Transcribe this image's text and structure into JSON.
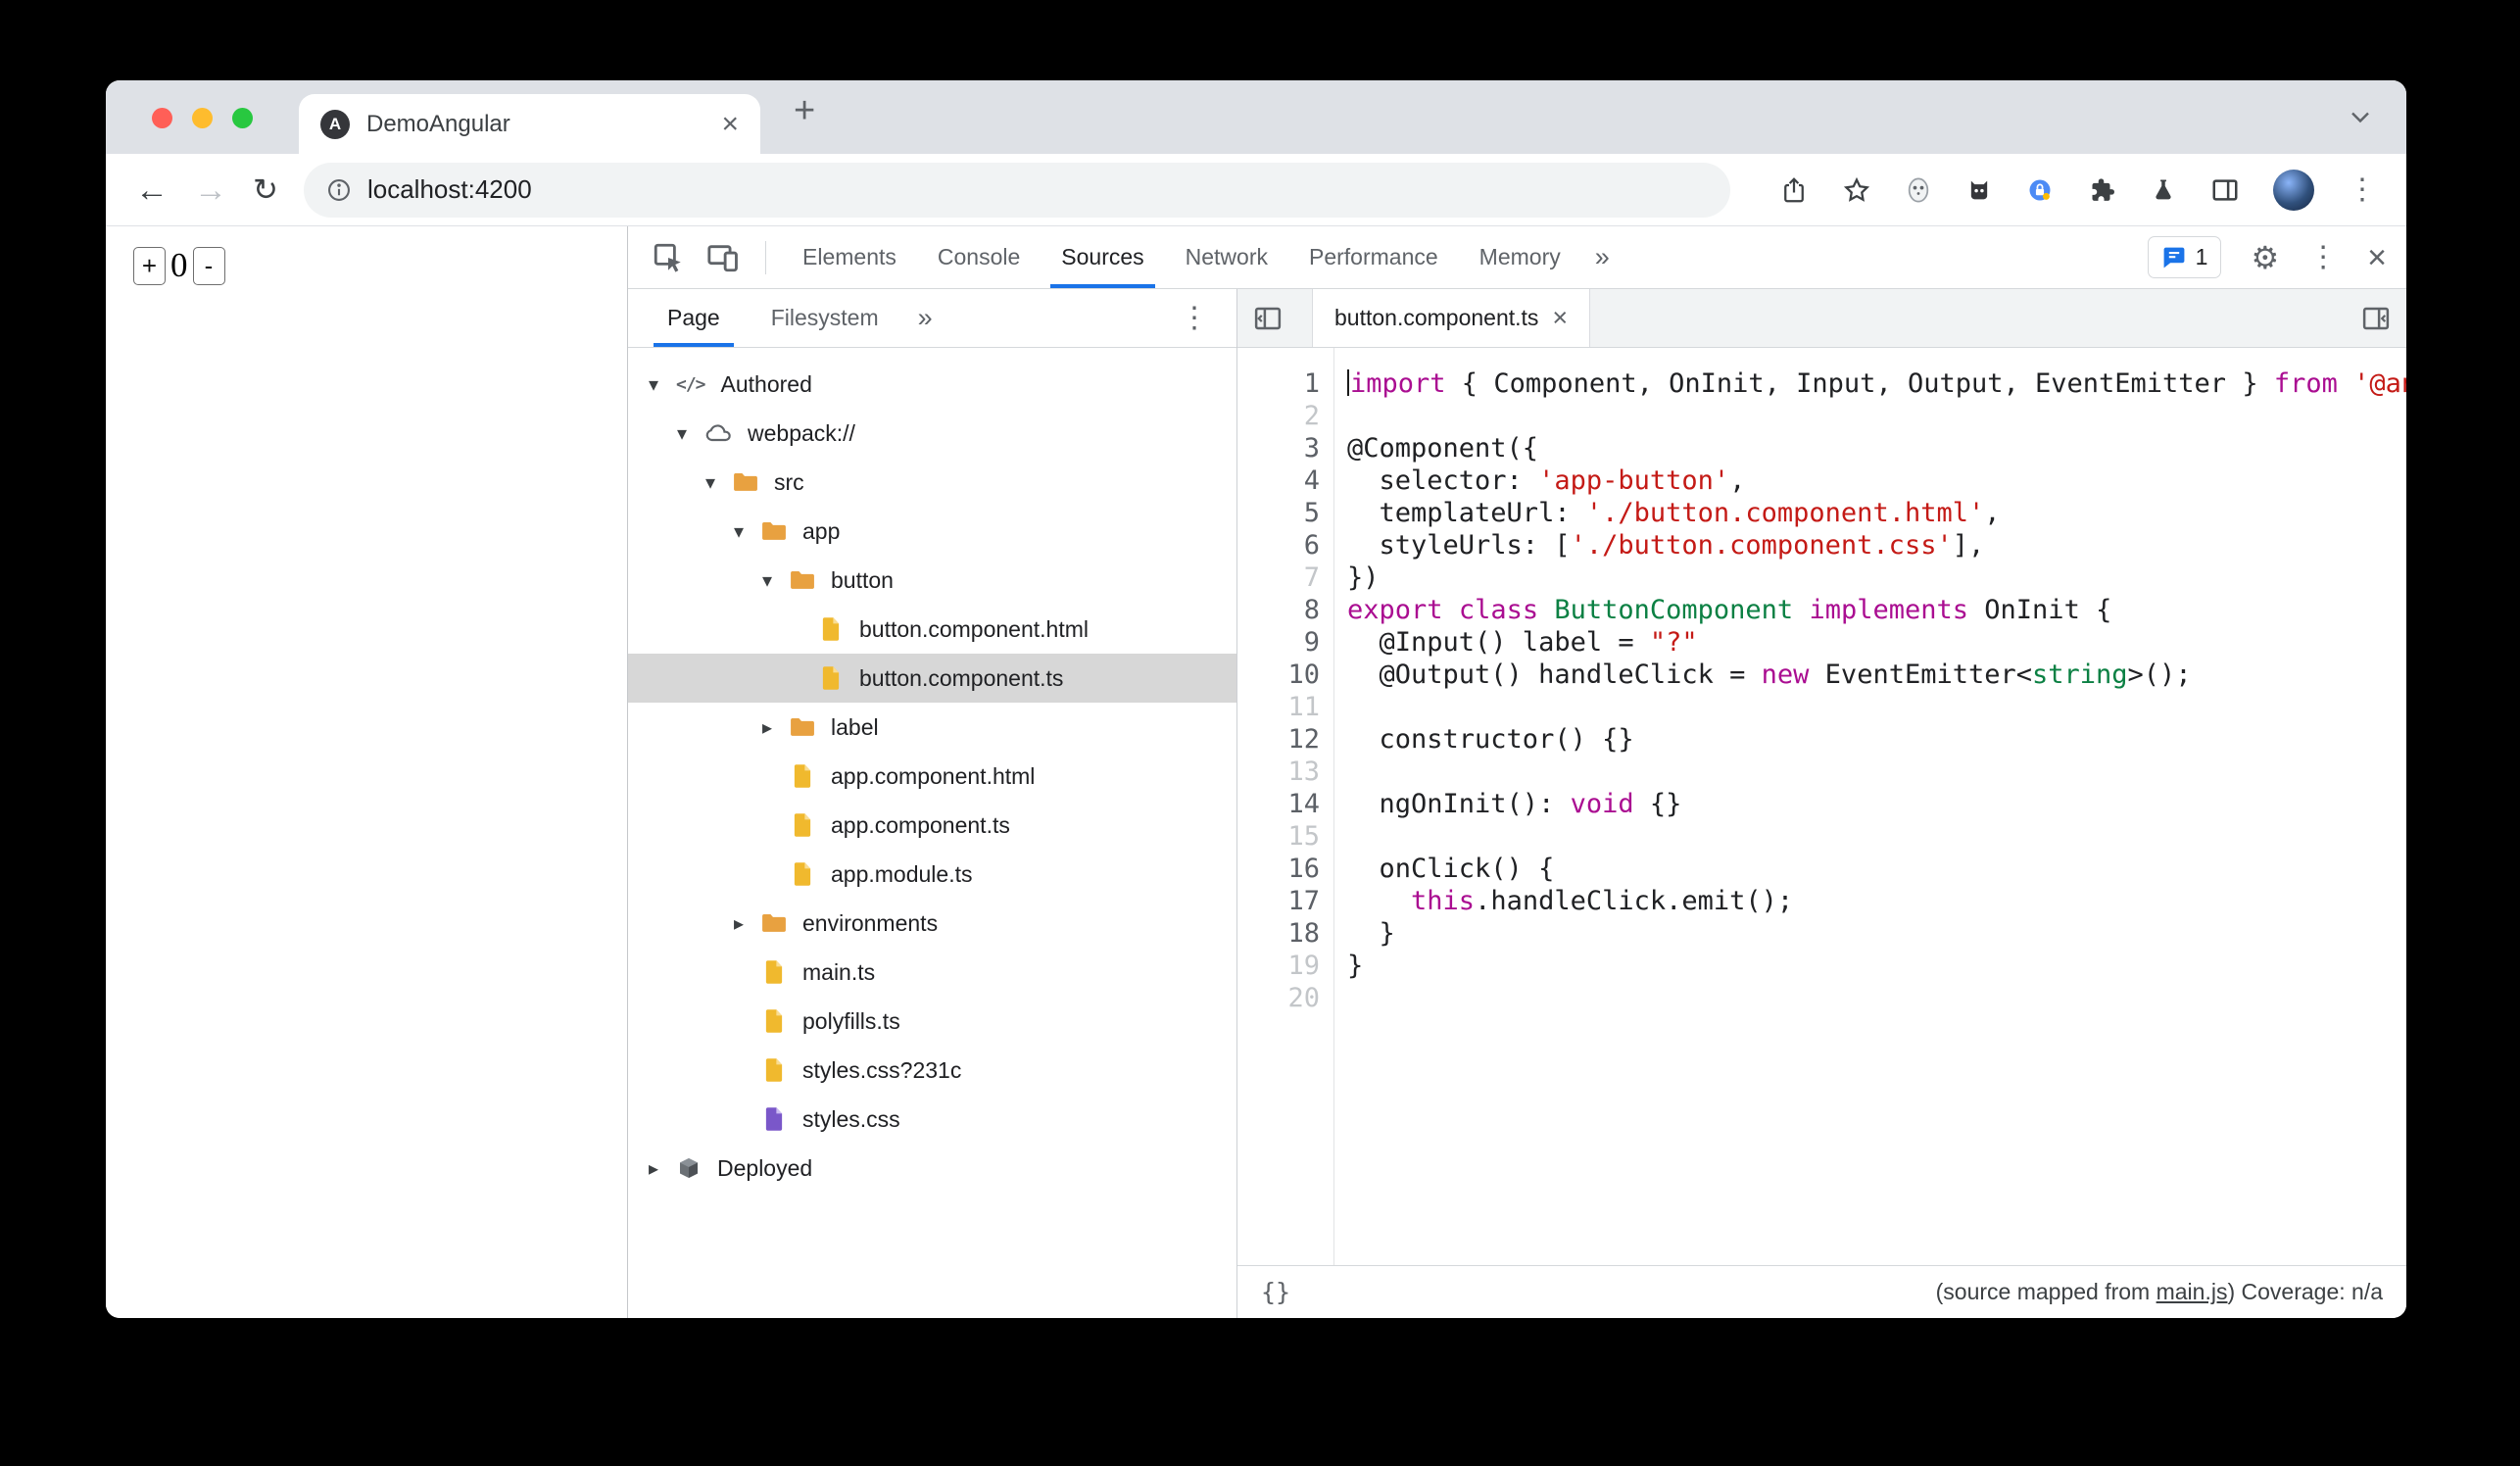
{
  "colors": {
    "accent": "#1a73e8",
    "keyword": "#aa0d91",
    "string": "#c41a16",
    "type": "#0b8043",
    "folder": "#e8a140",
    "file_yellow": "#f0b92e",
    "file_yellow_fold": "#f9dd94",
    "file_purple": "#7a57c9",
    "file_purple_fold": "#cdbcf2",
    "traffic_lights": [
      "#ff5f57",
      "#febc2e",
      "#28c840"
    ]
  },
  "icons": {
    "back": "←",
    "forward": "→",
    "reload": "↻",
    "new_tab": "+",
    "close": "×",
    "kebab": "⋮",
    "gear": "⚙",
    "more_tabs": "»",
    "expanded": "▾",
    "collapsed": "▸"
  },
  "browser": {
    "tab_title": "DemoAngular",
    "favicon_letter": "A",
    "url": "localhost:4200"
  },
  "page": {
    "counter": {
      "increment": "+",
      "value": "0",
      "decrement": "-"
    }
  },
  "devtools": {
    "main_tabs": [
      "Elements",
      "Console",
      "Sources",
      "Network",
      "Performance",
      "Memory"
    ],
    "active_main_tab": "Sources",
    "issues_count": "1",
    "navigator_tabs": [
      "Page",
      "Filesystem"
    ],
    "active_navigator_tab": "Page",
    "file_tree": [
      {
        "label": "Authored",
        "icon": "code-icon",
        "state": "expanded",
        "depth": 0
      },
      {
        "label": "webpack://",
        "icon": "cloud-icon",
        "state": "expanded",
        "depth": 1
      },
      {
        "label": "src",
        "icon": "folder-icon",
        "state": "expanded",
        "depth": 2
      },
      {
        "label": "app",
        "icon": "folder-icon",
        "state": "expanded",
        "depth": 3
      },
      {
        "label": "button",
        "icon": "folder-icon",
        "state": "expanded",
        "depth": 4
      },
      {
        "label": "button.component.html",
        "icon": "file-icon",
        "depth": 5
      },
      {
        "label": "button.component.ts",
        "icon": "file-icon",
        "depth": 5,
        "selected": true
      },
      {
        "label": "label",
        "icon": "folder-icon",
        "state": "collapsed",
        "depth": 4
      },
      {
        "label": "app.component.html",
        "icon": "file-icon",
        "depth": 4
      },
      {
        "label": "app.component.ts",
        "icon": "file-icon",
        "depth": 4
      },
      {
        "label": "app.module.ts",
        "icon": "file-icon",
        "depth": 4
      },
      {
        "label": "environments",
        "icon": "folder-icon",
        "state": "collapsed",
        "depth": 3
      },
      {
        "label": "main.ts",
        "icon": "file-icon",
        "depth": 3
      },
      {
        "label": "polyfills.ts",
        "icon": "file-icon",
        "depth": 3
      },
      {
        "label": "styles.css?231c",
        "icon": "file-icon",
        "depth": 3
      },
      {
        "label": "styles.css",
        "icon": "css-file-icon",
        "depth": 3
      },
      {
        "label": "Deployed",
        "icon": "package-icon",
        "state": "collapsed",
        "depth": 0
      }
    ],
    "editor": {
      "tab_label": "button.component.ts",
      "pretty_print_label": "{}",
      "status_prefix": "(source mapped from ",
      "status_link": "main.js",
      "status_suffix": ") Coverage: n/a",
      "lines": [
        {
          "n": 1,
          "caret": true,
          "tokens": [
            [
              "k",
              "import"
            ],
            [
              "p",
              " { Component, OnInit, Input, Output, EventEmitter } "
            ],
            [
              "k",
              "from"
            ],
            [
              "p",
              " "
            ],
            [
              "s",
              "'@angular/core';"
            ]
          ]
        },
        {
          "n": 2,
          "dim": true,
          "tokens": []
        },
        {
          "n": 3,
          "tokens": [
            [
              "p",
              "@Component({"
            ]
          ]
        },
        {
          "n": 4,
          "tokens": [
            [
              "p",
              "  selector: "
            ],
            [
              "s",
              "'app-button'"
            ],
            [
              "p",
              ","
            ]
          ]
        },
        {
          "n": 5,
          "tokens": [
            [
              "p",
              "  templateUrl: "
            ],
            [
              "s",
              "'./button.component.html'"
            ],
            [
              "p",
              ","
            ]
          ]
        },
        {
          "n": 6,
          "tokens": [
            [
              "p",
              "  styleUrls: ["
            ],
            [
              "s",
              "'./button.component.css'"
            ],
            [
              "p",
              "],"
            ]
          ]
        },
        {
          "n": 7,
          "dim": true,
          "tokens": [
            [
              "p",
              "})"
            ]
          ]
        },
        {
          "n": 8,
          "tokens": [
            [
              "k",
              "export"
            ],
            [
              "p",
              " "
            ],
            [
              "k",
              "class"
            ],
            [
              "p",
              " "
            ],
            [
              "t",
              "ButtonComponent"
            ],
            [
              "p",
              " "
            ],
            [
              "k",
              "implements"
            ],
            [
              "p",
              " OnInit {"
            ]
          ]
        },
        {
          "n": 9,
          "tokens": [
            [
              "p",
              "  @Input() label = "
            ],
            [
              "s",
              "\"?\""
            ]
          ]
        },
        {
          "n": 10,
          "tokens": [
            [
              "p",
              "  @Output() handleClick = "
            ],
            [
              "k",
              "new"
            ],
            [
              "p",
              " EventEmitter<"
            ],
            [
              "t",
              "string"
            ],
            [
              "p",
              ">();"
            ]
          ]
        },
        {
          "n": 11,
          "dim": true,
          "tokens": []
        },
        {
          "n": 12,
          "tokens": [
            [
              "p",
              "  constructor() {}"
            ]
          ]
        },
        {
          "n": 13,
          "dim": true,
          "tokens": []
        },
        {
          "n": 14,
          "tokens": [
            [
              "p",
              "  ngOnInit(): "
            ],
            [
              "k",
              "void"
            ],
            [
              "p",
              " {}"
            ]
          ]
        },
        {
          "n": 15,
          "dim": true,
          "tokens": []
        },
        {
          "n": 16,
          "tokens": [
            [
              "p",
              "  onClick() {"
            ]
          ]
        },
        {
          "n": 17,
          "tokens": [
            [
              "p",
              "    "
            ],
            [
              "k",
              "this"
            ],
            [
              "p",
              ".handleClick.emit();"
            ]
          ]
        },
        {
          "n": 18,
          "tokens": [
            [
              "p",
              "  }"
            ]
          ]
        },
        {
          "n": 19,
          "dim": true,
          "tokens": [
            [
              "p",
              "}"
            ]
          ]
        },
        {
          "n": 20,
          "dim": true,
          "tokens": []
        }
      ]
    }
  }
}
